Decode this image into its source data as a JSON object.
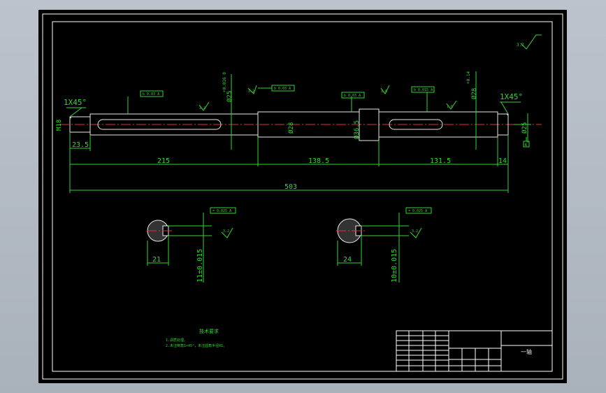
{
  "drawing": {
    "chamfer_left": "1X45°",
    "chamfer_right": "1X45°",
    "thread_left": "M18",
    "dia_right_end": "Ø25",
    "dia_mid": "Ø28",
    "dia_shoulder": "Ø36.5",
    "dia_key1": "Ø25",
    "dia_key2": "Ø28",
    "tol_key1": "+0.016 0",
    "tol_key2": "+0.14",
    "len_end": "23.5",
    "len_seg1": "215",
    "len_seg2": "138.5",
    "len_seg3": "131.5",
    "len_seg4": "14",
    "len_total": "503",
    "rough_top": "3.2",
    "rough_a": "3.2",
    "rough_b": "3.2",
    "rough_c": "1.6",
    "rough_d": "1.6",
    "section1_width": "11±0.015",
    "section1_depth": "21",
    "section2_width": "10±0.015",
    "section2_depth": "24",
    "section1_rough": "3.2",
    "section2_rough": "3.2",
    "tol_frame_1": "b 0.03 A",
    "tol_frame_2": "b 0.03 A",
    "tol_frame_3": "b 0.03 A",
    "tol_frame_4": "b 0.015 A",
    "tol_frame_s1": "= 0.025 A",
    "tol_frame_s2": "= 0.025 A",
    "datum": "A"
  },
  "notes": {
    "heading": "技术要求",
    "line1": "1.调质处理。",
    "line2": "2.未注倒角1×45°，未注圆角半径R1。"
  },
  "title_block": {
    "part_name": "一轴"
  }
}
